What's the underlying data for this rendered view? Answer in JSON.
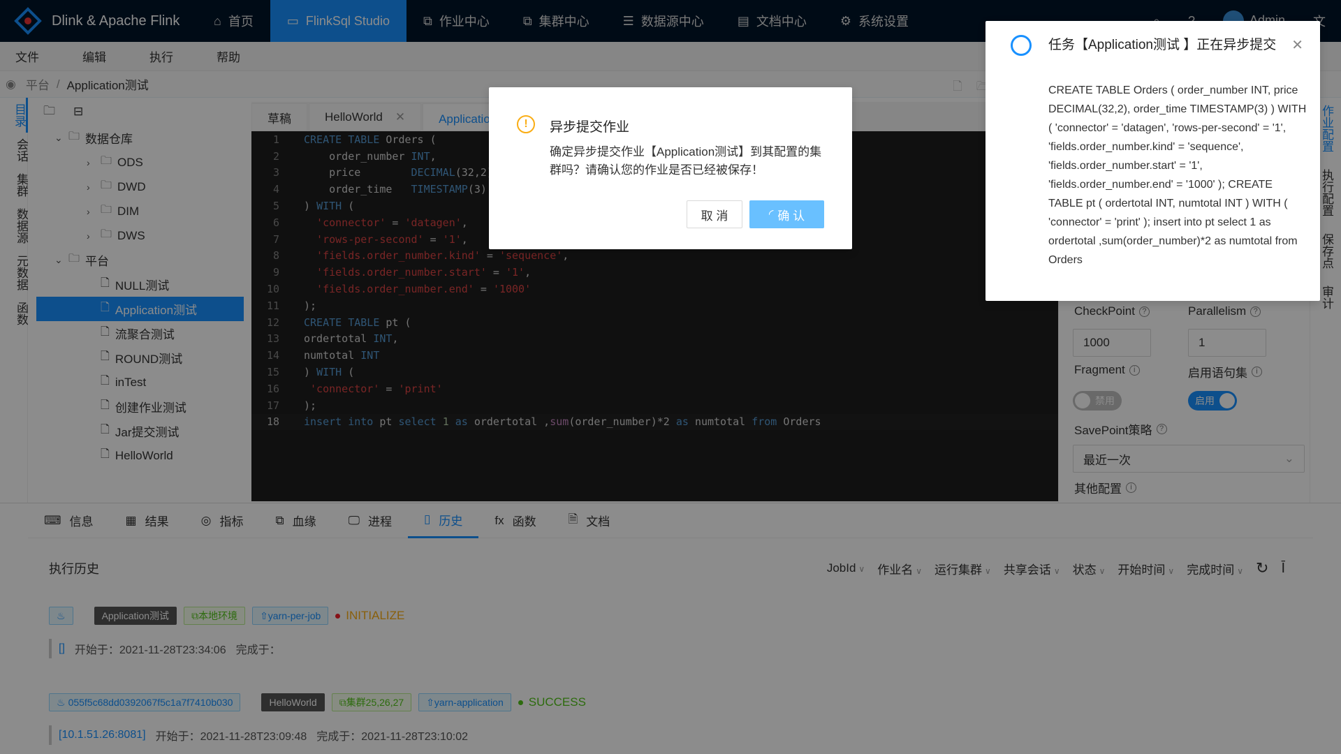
{
  "header": {
    "brand": "Dlink & Apache Flink",
    "nav": [
      {
        "label": "首页",
        "icon": "home-icon"
      },
      {
        "label": "FlinkSql Studio",
        "icon": "sql-icon",
        "active": true
      },
      {
        "label": "作业中心",
        "icon": "cluster-icon"
      },
      {
        "label": "集群中心",
        "icon": "cluster-icon"
      },
      {
        "label": "数据源中心",
        "icon": "database-icon"
      },
      {
        "label": "文档中心",
        "icon": "document-icon"
      },
      {
        "label": "系统设置",
        "icon": "gear-icon"
      }
    ],
    "user": "Admin",
    "lang_icon": "translate-icon"
  },
  "menubar": [
    "文件",
    "编辑",
    "执行",
    "帮助"
  ],
  "breadcrumb": [
    "平台",
    "Application测试"
  ],
  "rail": [
    {
      "label": "目录",
      "active": true
    },
    {
      "label": "会话"
    },
    {
      "label": "集群"
    },
    {
      "label": "数据源"
    },
    {
      "label": "元数据"
    },
    {
      "label": "函数"
    }
  ],
  "tree": [
    {
      "label": "数据仓库",
      "level": 0,
      "type": "folder-open",
      "caret": "v"
    },
    {
      "label": "ODS",
      "level": 1,
      "type": "folder",
      "caret": ">"
    },
    {
      "label": "DWD",
      "level": 1,
      "type": "folder",
      "caret": ">"
    },
    {
      "label": "DIM",
      "level": 1,
      "type": "folder",
      "caret": ">"
    },
    {
      "label": "DWS",
      "level": 1,
      "type": "folder",
      "caret": ">"
    },
    {
      "label": "平台",
      "level": 0,
      "type": "folder-open",
      "caret": "v"
    },
    {
      "label": "NULL测试",
      "level": 1,
      "type": "file"
    },
    {
      "label": "Application测试",
      "level": 1,
      "type": "file",
      "selected": true
    },
    {
      "label": "流聚合测试",
      "level": 1,
      "type": "file"
    },
    {
      "label": "ROUND测试",
      "level": 1,
      "type": "file"
    },
    {
      "label": "inTest",
      "level": 1,
      "type": "file"
    },
    {
      "label": "创建作业测试",
      "level": 1,
      "type": "file"
    },
    {
      "label": "Jar提交测试",
      "level": 1,
      "type": "file"
    },
    {
      "label": "HelloWorld",
      "level": 1,
      "type": "file"
    }
  ],
  "editor": {
    "tabs": [
      {
        "label": "草稿"
      },
      {
        "label": "HelloWorld",
        "closable": true
      },
      {
        "label": "Application测试",
        "active": true
      }
    ],
    "lines": [
      [
        [
          "k",
          "CREATE TABLE "
        ],
        [
          "t",
          "Orders ("
        ]
      ],
      [
        [
          "t",
          "    order_number "
        ],
        [
          "k",
          "INT"
        ],
        [
          "t",
          ","
        ]
      ],
      [
        [
          "t",
          "    price        "
        ],
        [
          "k",
          "DECIMAL"
        ],
        [
          "t",
          "(32,2),"
        ]
      ],
      [
        [
          "t",
          "    order_time   "
        ],
        [
          "k",
          "TIMESTAMP"
        ],
        [
          "t",
          "(3)"
        ]
      ],
      [
        [
          "t",
          ") "
        ],
        [
          "k",
          "WITH"
        ],
        [
          "t",
          " ("
        ]
      ],
      [
        [
          "s",
          "  'connector'"
        ],
        [
          "t",
          " = "
        ],
        [
          "s",
          "'datagen'"
        ],
        [
          "t",
          ","
        ]
      ],
      [
        [
          "s",
          "  'rows-per-second'"
        ],
        [
          "t",
          " = "
        ],
        [
          "s",
          "'1'"
        ],
        [
          "t",
          ","
        ]
      ],
      [
        [
          "s",
          "  'fields.order_number.kind'"
        ],
        [
          "t",
          " = "
        ],
        [
          "s",
          "'sequence'"
        ],
        [
          "t",
          ","
        ]
      ],
      [
        [
          "s",
          "  'fields.order_number.start'"
        ],
        [
          "t",
          " = "
        ],
        [
          "s",
          "'1'"
        ],
        [
          "t",
          ","
        ]
      ],
      [
        [
          "s",
          "  'fields.order_number.end'"
        ],
        [
          "t",
          " = "
        ],
        [
          "s",
          "'1000'"
        ]
      ],
      [
        [
          "t",
          ");"
        ]
      ],
      [
        [
          "k",
          "CREATE TABLE "
        ],
        [
          "t",
          "pt ("
        ]
      ],
      [
        [
          "t",
          "ordertotal "
        ],
        [
          "k",
          "INT"
        ],
        [
          "t",
          ","
        ]
      ],
      [
        [
          "t",
          "numtotal "
        ],
        [
          "k",
          "INT"
        ]
      ],
      [
        [
          "t",
          ") "
        ],
        [
          "k",
          "WITH"
        ],
        [
          "t",
          " ("
        ]
      ],
      [
        [
          "s",
          " 'connector'"
        ],
        [
          "t",
          " = "
        ],
        [
          "s",
          "'print'"
        ]
      ],
      [
        [
          "t",
          ");"
        ]
      ],
      [
        [
          "k",
          "insert into "
        ],
        [
          "t",
          "pt "
        ],
        [
          "k",
          "select "
        ],
        [
          "n",
          "1 "
        ],
        [
          "k",
          "as "
        ],
        [
          "t",
          "ordertotal ,"
        ],
        [
          "f",
          "sum"
        ],
        [
          "t",
          "(order_number)*2 "
        ],
        [
          "k",
          "as "
        ],
        [
          "t",
          "numtotal "
        ],
        [
          "k",
          "from "
        ],
        [
          "t",
          "Orders"
        ]
      ]
    ]
  },
  "config": {
    "checkpoint_label": "CheckPoint",
    "checkpoint_value": "1000",
    "parallelism_label": "Parallelism",
    "parallelism_value": "1",
    "fragment_label": "Fragment",
    "fragment_state": "禁用",
    "fragment_on": false,
    "statement_set_label": "启用语句集",
    "statement_set_state": "启用",
    "statement_set_on": true,
    "savepoint_label": "SavePoint策略",
    "savepoint_value": "最近一次",
    "other_label": "其他配置"
  },
  "vtabs": [
    {
      "label": "作业配置",
      "active": true
    },
    {
      "label": "执行配置"
    },
    {
      "label": "保存点"
    },
    {
      "label": "审计"
    }
  ],
  "bottom": {
    "tabs": [
      {
        "label": "信息"
      },
      {
        "label": "结果"
      },
      {
        "label": "指标"
      },
      {
        "label": "血缘"
      },
      {
        "label": "进程"
      },
      {
        "label": "历史",
        "active": true
      },
      {
        "label": "函数"
      },
      {
        "label": "文档"
      }
    ],
    "title": "执行历史",
    "filters": [
      "JobId",
      "作业名",
      "运行集群",
      "共享会话",
      "状态",
      "开始时间",
      "完成时间"
    ],
    "records": [
      {
        "jobid": "",
        "name": "Application测试",
        "cluster": "本地环境",
        "type": "yarn-per-job",
        "status": "INITIALIZE",
        "status_color": "#faad14",
        "address": "[]",
        "start": "开始于：2021-11-28T23:34:06",
        "end": "完成于："
      },
      {
        "jobid": "055f5c68dd0392067f5c1a7f7410b030",
        "name": "HelloWorld",
        "cluster": "集群25,26,27",
        "type": "yarn-application",
        "status": "SUCCESS",
        "status_color": "#52c41a",
        "address": "[10.1.51.26:8081]",
        "start": "开始于：2021-11-28T23:09:48",
        "end": "完成于：2021-11-28T23:10:02"
      }
    ]
  },
  "modal": {
    "title": "异步提交作业",
    "body": "确定异步提交作业【Application测试】到其配置的集群吗？请确认您的作业是否已经被保存！",
    "cancel": "取 消",
    "ok": "确 认"
  },
  "notification": {
    "title": "任务【Application测试 】正在异步提交",
    "body": "CREATE TABLE Orders ( order_number INT, price DECIMAL(32,2), order_time TIMESTAMP(3) ) WITH ( 'connector' = 'datagen', 'rows-per-second' = '1', 'fields.order_number.kind' = 'sequence', 'fields.order_number.start' = '1', 'fields.order_number.end' = '1000' ); CREATE TABLE pt ( ordertotal INT, numtotal INT ) WITH ( 'connector' = 'print' ); insert into pt select 1 as ordertotal ,sum(order_number)*2 as numtotal from Orders"
  },
  "colors": {
    "primary": "#1890ff",
    "header": "#001529",
    "warning": "#faad14",
    "success": "#52c41a"
  }
}
